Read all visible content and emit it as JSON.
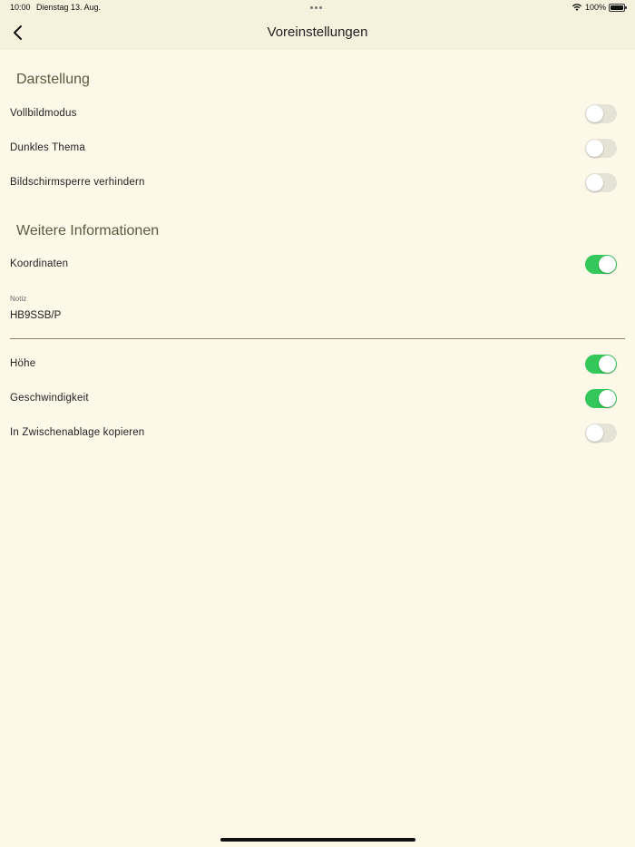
{
  "status_bar": {
    "time": "10:00",
    "date": "Dienstag 13. Aug.",
    "battery": "100%",
    "battery_level": 1.0
  },
  "nav": {
    "title": "Voreinstellungen",
    "back_icon": "chevron-left-icon"
  },
  "sections": {
    "display": {
      "title": "Darstellung",
      "items": [
        {
          "label": "Vollbildmodus",
          "on": false
        },
        {
          "label": "Dunkles Thema",
          "on": false
        },
        {
          "label": "Bildschirmsperre verhindern",
          "on": false
        }
      ]
    },
    "info": {
      "title": "Weitere Informationen",
      "coordinates": {
        "label": "Koordinaten",
        "on": true
      },
      "note": {
        "label": "Notiz",
        "value": "HB9SSB/P"
      },
      "items": [
        {
          "label": "Höhe",
          "on": true
        },
        {
          "label": "Geschwindigkeit",
          "on": true
        },
        {
          "label": "In Zwischenablage kopieren",
          "on": false
        }
      ]
    }
  },
  "colors": {
    "background": "#fdf8e8",
    "bar": "#f6f1dc",
    "toggle_on": "#34c759",
    "toggle_off": "#e5e2d6",
    "section_title": "#5c5a3f"
  }
}
